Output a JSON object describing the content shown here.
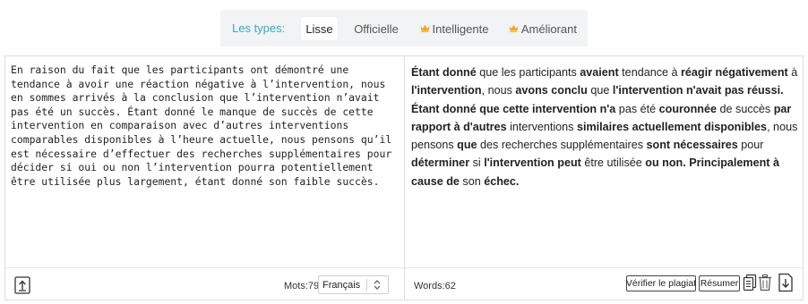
{
  "modes": {
    "label": "Les types:",
    "tabs": [
      {
        "label": "Lisse",
        "active": true,
        "premium": false
      },
      {
        "label": "Officielle",
        "active": false,
        "premium": false
      },
      {
        "label": "Intelligente",
        "active": false,
        "premium": true
      },
      {
        "label": "Améliorant",
        "active": false,
        "premium": true
      }
    ],
    "accent_color": "#3aa9c4",
    "crown_color": "#f0a92b"
  },
  "input": {
    "text": "En raison du fait que les participants ont démontré une tendance à avoir une réaction négative à l’intervention, nous en sommes arrivés à la conclusion que l’intervention n’avait pas été un succès. Étant donné le manque de succès de cette intervention en comparaison avec d’autres interventions comparables disponibles à l’heure actuelle, nous pensons qu’il est nécessaire d’effectuer des recherches supplémentaires pour décider si oui ou non l’intervention pourra potentiellement être utilisée plus largement, étant donné son faible succès.",
    "word_count_label": "Mots:79",
    "language": "Français",
    "upload_icon": "upload-icon"
  },
  "output": {
    "segments": [
      {
        "t": "Étant donné",
        "b": true
      },
      {
        "t": " que les participants ",
        "b": false
      },
      {
        "t": "avaient",
        "b": true
      },
      {
        "t": " tendance à ",
        "b": false
      },
      {
        "t": "réagir négativement",
        "b": true
      },
      {
        "t": " à ",
        "b": false
      },
      {
        "t": "l'intervention",
        "b": true
      },
      {
        "t": ", nous ",
        "b": false
      },
      {
        "t": "avons conclu",
        "b": true
      },
      {
        "t": " que ",
        "b": false
      },
      {
        "t": "l'intervention n'avait pas réussi.",
        "b": true
      },
      {
        "t": " ",
        "b": false
      },
      {
        "t": "Étant donné que cette intervention n'a",
        "b": true
      },
      {
        "t": " pas été ",
        "b": false
      },
      {
        "t": "couronnée",
        "b": true
      },
      {
        "t": " de succès ",
        "b": false
      },
      {
        "t": "par rapport à d'autres",
        "b": true
      },
      {
        "t": " interventions ",
        "b": false
      },
      {
        "t": "similaires actuellement disponibles",
        "b": true
      },
      {
        "t": ", nous pensons ",
        "b": false
      },
      {
        "t": "que",
        "b": true
      },
      {
        "t": " des recherches supplémentaires ",
        "b": false
      },
      {
        "t": "sont nécessaires",
        "b": true
      },
      {
        "t": " pour ",
        "b": false
      },
      {
        "t": "déterminer",
        "b": true
      },
      {
        "t": " si ",
        "b": false
      },
      {
        "t": "l'intervention peut",
        "b": true
      },
      {
        "t": " être utilisée ",
        "b": false
      },
      {
        "t": "ou non. Principalement à cause de",
        "b": true
      },
      {
        "t": " son ",
        "b": false
      },
      {
        "t": "échec.",
        "b": true
      }
    ],
    "word_count_label": "Words:62",
    "buttons": {
      "plagiarism": "Vérifier le plagiat",
      "summarize": "Résumer"
    },
    "icons": [
      "copy-icon",
      "trash-icon",
      "download-icon"
    ]
  }
}
